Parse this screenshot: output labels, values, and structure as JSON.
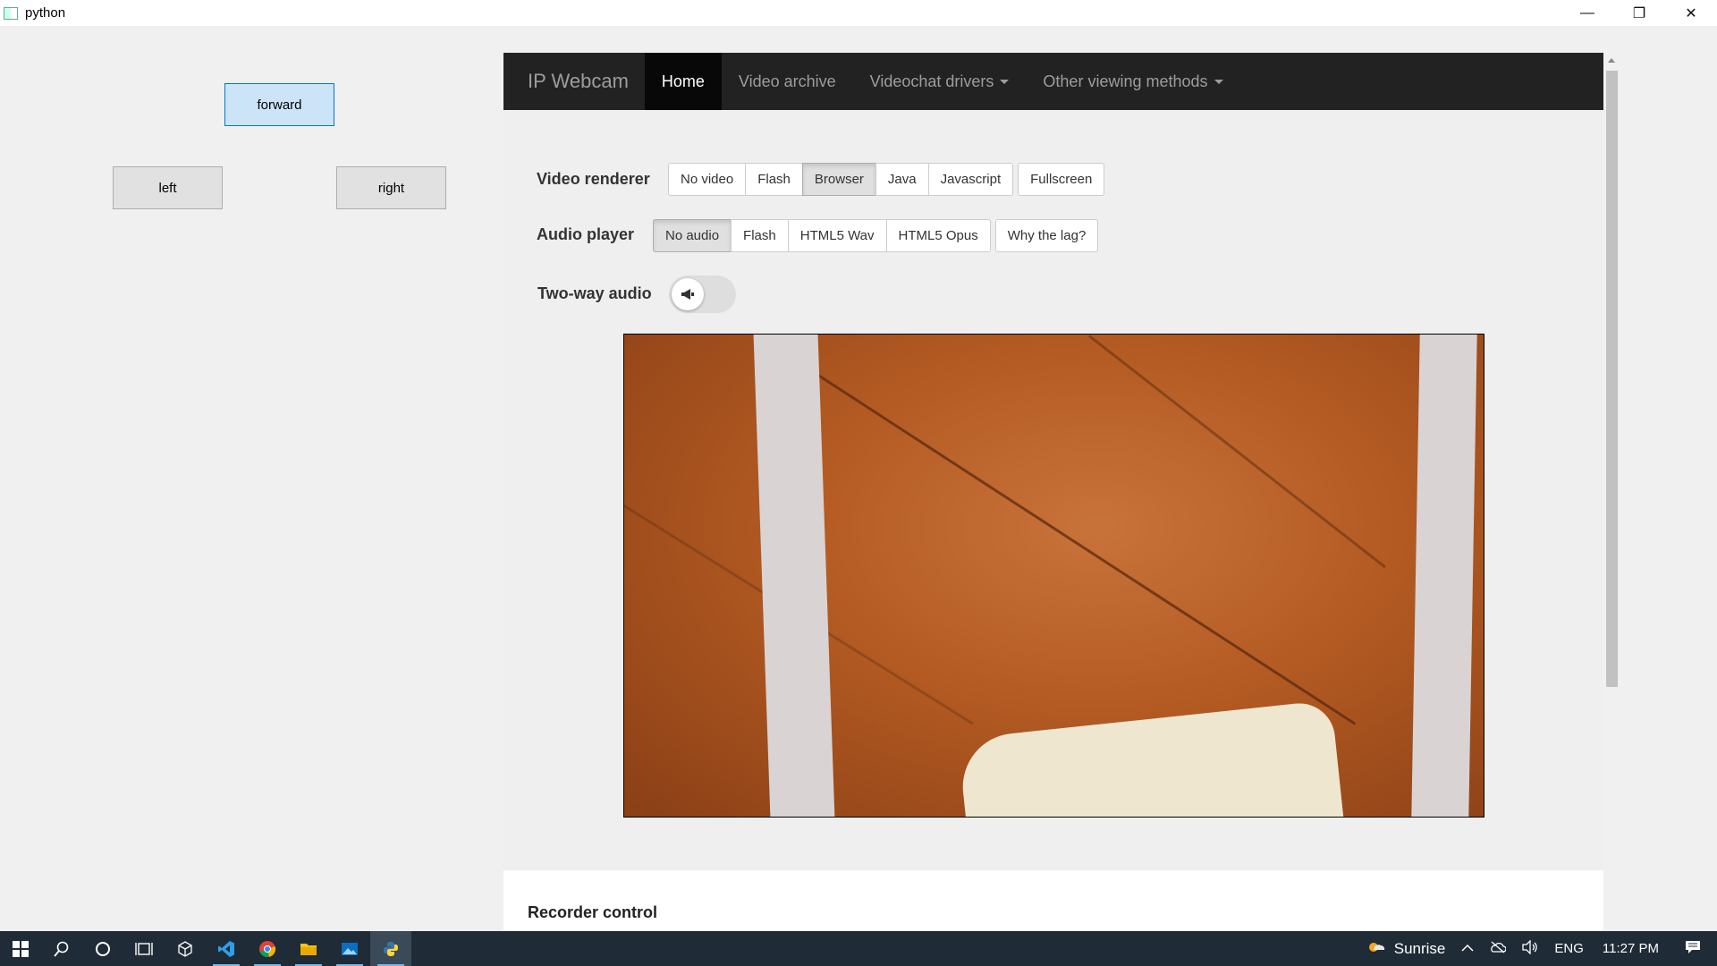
{
  "window": {
    "title": "python"
  },
  "controls": {
    "forward": "forward",
    "left": "left",
    "right": "right"
  },
  "navbar": {
    "brand": "IP Webcam",
    "items": [
      {
        "label": "Home",
        "active": true,
        "dropdown": false
      },
      {
        "label": "Video archive",
        "active": false,
        "dropdown": false
      },
      {
        "label": "Videochat drivers",
        "active": false,
        "dropdown": true
      },
      {
        "label": "Other viewing methods",
        "active": false,
        "dropdown": true
      }
    ]
  },
  "video_renderer": {
    "label": "Video renderer",
    "options": [
      "No video",
      "Flash",
      "Browser",
      "Java",
      "Javascript"
    ],
    "selected": "Browser",
    "extra": "Fullscreen"
  },
  "audio_player": {
    "label": "Audio player",
    "options": [
      "No audio",
      "Flash",
      "HTML5 Wav",
      "HTML5 Opus"
    ],
    "selected": "No audio",
    "extra": "Why the lag?"
  },
  "two_way_audio": {
    "label": "Two-way audio",
    "enabled": false
  },
  "recorder": {
    "title": "Recorder control"
  },
  "taskbar": {
    "weather": "Sunrise",
    "language": "ENG",
    "time": "11:27 PM"
  }
}
